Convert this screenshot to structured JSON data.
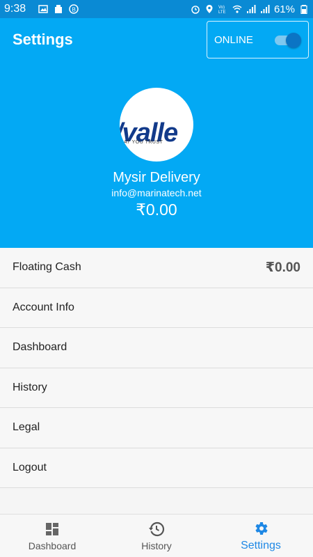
{
  "status_bar": {
    "time": "9:38",
    "battery": "61%"
  },
  "header": {
    "title": "Settings",
    "online_label": "ONLINE",
    "online_toggle_on": true
  },
  "profile": {
    "logo_text": "/valle",
    "logo_tagline": "AT YOU TRUST",
    "name": "Mysir Delivery",
    "email": "info@marinatech.net",
    "balance": "₹0.00"
  },
  "menu": [
    {
      "label": "Floating Cash",
      "value": "₹0.00"
    },
    {
      "label": "Account Info"
    },
    {
      "label": "Dashboard"
    },
    {
      "label": "History"
    },
    {
      "label": "Legal"
    },
    {
      "label": "Logout"
    }
  ],
  "bottom_nav": [
    {
      "label": "Dashboard",
      "icon": "dashboard-icon"
    },
    {
      "label": "History",
      "icon": "history-icon"
    },
    {
      "label": "Settings",
      "icon": "gear-icon",
      "active": true
    }
  ],
  "colors": {
    "primary": "#03a9f4",
    "status_bar": "#0a8ad4",
    "active_nav": "#1e88e5"
  }
}
